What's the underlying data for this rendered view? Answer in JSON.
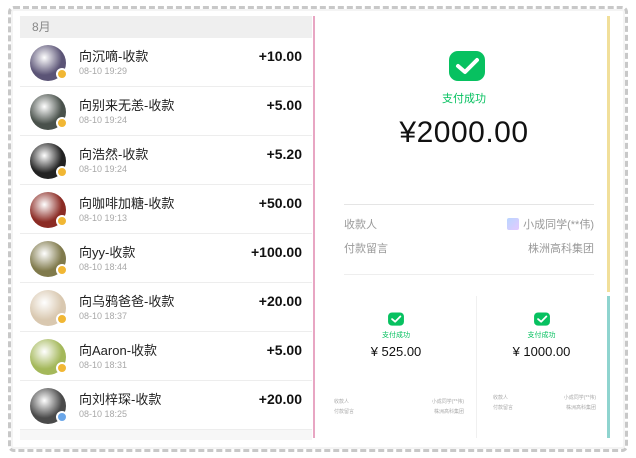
{
  "month_header": "8月",
  "transactions": [
    {
      "title": "向沉嘀-收款",
      "time": "08-10  19:29",
      "amount": "+10.00",
      "avatar": "avatar-1",
      "avatar_color": "#5b5476",
      "badge_color": "#f1b734"
    },
    {
      "title": "向别来无恙-收款",
      "time": "08-10  19:24",
      "amount": "+5.00",
      "avatar": "avatar-2",
      "avatar_color": "#49514b",
      "badge_color": "#f1b734"
    },
    {
      "title": "向浩然-收款",
      "time": "08-10  19:24",
      "amount": "+5.20",
      "avatar": "avatar-3",
      "avatar_color": "#222222",
      "badge_color": "#f1b734"
    },
    {
      "title": "向咖啡加糖-收款",
      "time": "08-10  19:13",
      "amount": "+50.00",
      "avatar": "avatar-4",
      "avatar_color": "#8b2b24",
      "badge_color": "#f1b734"
    },
    {
      "title": "向yy-收款",
      "time": "08-10  18:44",
      "amount": "+100.00",
      "avatar": "avatar-5",
      "avatar_color": "#807a4c",
      "badge_color": "#f1b734"
    },
    {
      "title": "向乌鸦爸爸-收款",
      "time": "08-10  18:37",
      "amount": "+20.00",
      "avatar": "avatar-6",
      "avatar_color": "#d9c8b0",
      "badge_color": "#f1b734"
    },
    {
      "title": "向Aaron-收款",
      "time": "08-10  18:31",
      "amount": "+5.00",
      "avatar": "avatar-7",
      "avatar_color": "#a4b85a",
      "badge_color": "#f1b734"
    },
    {
      "title": "向刘梓琛-收款",
      "time": "08-10  18:25",
      "amount": "+20.00",
      "avatar": "avatar-8",
      "avatar_color": "#4a4a4a",
      "badge_color": "#6aa6e8"
    }
  ],
  "main_card": {
    "status": "支付成功",
    "amount": "¥2000.00",
    "payee_label": "收款人",
    "payee_value": "小成同学(**伟)",
    "note_label": "付款留言",
    "note_value": "株洲高科集团"
  },
  "mini_cards": [
    {
      "status": "支付成功",
      "amount": "¥ 525.00",
      "payee_label": "收款人",
      "payee_value": "小成同学(**伟)",
      "note_label": "付款留言",
      "note_value": "株洲高科集团"
    },
    {
      "status": "支付成功",
      "amount": "¥ 1000.00",
      "payee_label": "收款人",
      "payee_value": "小成同学(**伟)",
      "note_label": "付款留言",
      "note_value": "株洲高科集团"
    }
  ],
  "colors": {
    "wechat_green": "#07c160",
    "pink_divider": "#e8a6c3",
    "gold_line": "#f1df9a",
    "teal_line": "#8fd4cf"
  },
  "icons": {
    "wechat_pay": "wechat-pay-check-icon",
    "verified_badge": "badge-icon"
  }
}
